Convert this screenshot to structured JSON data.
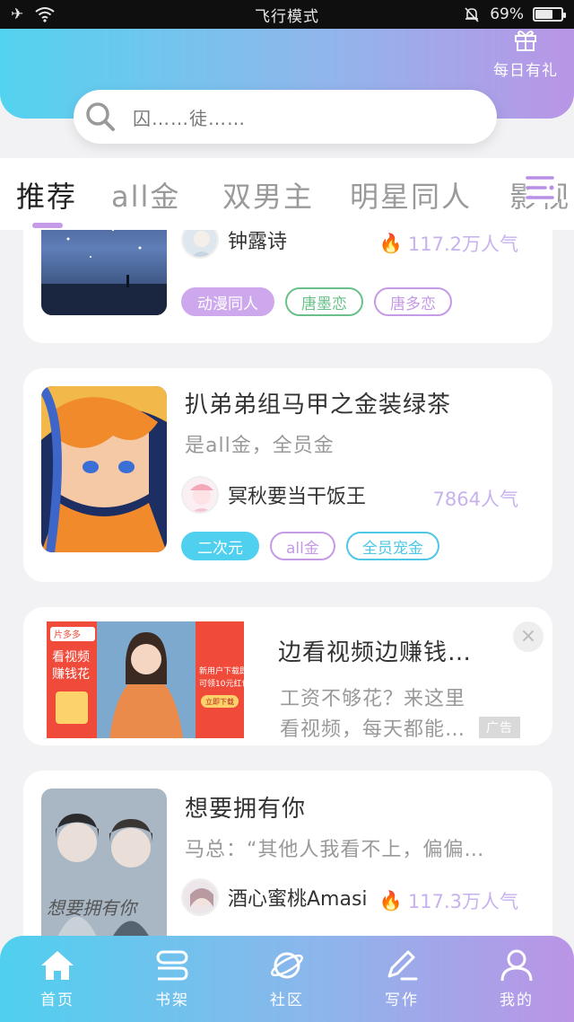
{
  "status_bar": {
    "center_text": "飞行模式",
    "battery_text": "69%",
    "battery_level": 0.69
  },
  "header": {
    "gift_label": "每日有礼",
    "search_placeholder": "囚……徒……"
  },
  "tabs": [
    "推荐",
    "all金",
    "双男主",
    "明星同人",
    "影视"
  ],
  "cards": [
    {
      "author": "钟露诗",
      "popularity": "117.2万人气",
      "tags": [
        "动漫同人",
        "唐墨恋",
        "唐多恋"
      ]
    },
    {
      "title": "扒弟弟组马甲之金装绿茶",
      "desc": "是all金，全员金",
      "author": "冥秋要当干饭王",
      "popularity": "7864人气",
      "tags": [
        "二次元",
        "all金",
        "全员宠金"
      ]
    },
    {
      "title": "想要拥有你",
      "desc": "马总：“其他人我看不上，偏偏…",
      "author": "酒心蜜桃Amasi",
      "popularity": "117.3万人气",
      "cover_text": "想要拥有你"
    }
  ],
  "ad": {
    "title": "边看视频边赚钱…",
    "desc_line1": "工资不够花？来这里",
    "desc_line2": "看视频，每天都能…",
    "badge": "广告",
    "close": "×",
    "brand": "片多多",
    "slogan1": "看视频",
    "slogan2": "赚钱花",
    "promo1": "新用户下载即",
    "promo2": "可领10元红包",
    "download": "立即下载"
  },
  "bottom_nav": [
    "首页",
    "书架",
    "社区",
    "写作",
    "我的"
  ],
  "colors": {
    "accent_gradient_start": "#53d3ef",
    "accent_gradient_end": "#b995e6",
    "purple": "#c59ae6",
    "cyan": "#4fd0ee",
    "green": "#6ac08a"
  }
}
